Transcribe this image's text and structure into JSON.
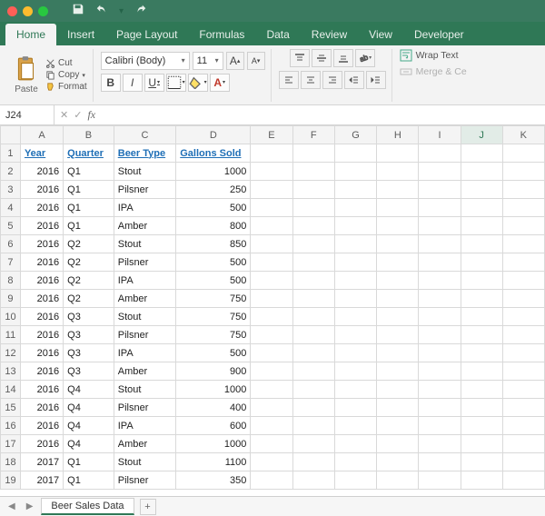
{
  "ribbon": {
    "tabs": [
      "Home",
      "Insert",
      "Page Layout",
      "Formulas",
      "Data",
      "Review",
      "View",
      "Developer"
    ],
    "active_tab": "Home",
    "paste_label": "Paste",
    "cut_label": "Cut",
    "copy_label": "Copy",
    "format_label": "Format",
    "font_name": "Calibri (Body)",
    "font_size": "11",
    "size_up": "A",
    "size_down": "A",
    "bold": "B",
    "italic": "I",
    "underline": "U",
    "wrap_label": "Wrap Text",
    "merge_label": "Merge & Ce"
  },
  "namebox": "J24",
  "fx_label": "fx",
  "columns": [
    "A",
    "B",
    "C",
    "D",
    "E",
    "F",
    "G",
    "H",
    "I",
    "J",
    "K"
  ],
  "selected_column": "J",
  "headers": {
    "A": "Year",
    "B": "Quarter",
    "C": "Beer Type",
    "D": "Gallons Sold"
  },
  "rows": [
    {
      "n": 2,
      "year": 2016,
      "quarter": "Q1",
      "beer": "Stout",
      "gallons": 1000
    },
    {
      "n": 3,
      "year": 2016,
      "quarter": "Q1",
      "beer": "Pilsner",
      "gallons": 250
    },
    {
      "n": 4,
      "year": 2016,
      "quarter": "Q1",
      "beer": "IPA",
      "gallons": 500
    },
    {
      "n": 5,
      "year": 2016,
      "quarter": "Q1",
      "beer": "Amber",
      "gallons": 800
    },
    {
      "n": 6,
      "year": 2016,
      "quarter": "Q2",
      "beer": "Stout",
      "gallons": 850
    },
    {
      "n": 7,
      "year": 2016,
      "quarter": "Q2",
      "beer": "Pilsner",
      "gallons": 500
    },
    {
      "n": 8,
      "year": 2016,
      "quarter": "Q2",
      "beer": "IPA",
      "gallons": 500
    },
    {
      "n": 9,
      "year": 2016,
      "quarter": "Q2",
      "beer": "Amber",
      "gallons": 750
    },
    {
      "n": 10,
      "year": 2016,
      "quarter": "Q3",
      "beer": "Stout",
      "gallons": 750
    },
    {
      "n": 11,
      "year": 2016,
      "quarter": "Q3",
      "beer": "Pilsner",
      "gallons": 750
    },
    {
      "n": 12,
      "year": 2016,
      "quarter": "Q3",
      "beer": "IPA",
      "gallons": 500
    },
    {
      "n": 13,
      "year": 2016,
      "quarter": "Q3",
      "beer": "Amber",
      "gallons": 900
    },
    {
      "n": 14,
      "year": 2016,
      "quarter": "Q4",
      "beer": "Stout",
      "gallons": 1000
    },
    {
      "n": 15,
      "year": 2016,
      "quarter": "Q4",
      "beer": "Pilsner",
      "gallons": 400
    },
    {
      "n": 16,
      "year": 2016,
      "quarter": "Q4",
      "beer": "IPA",
      "gallons": 600
    },
    {
      "n": 17,
      "year": 2016,
      "quarter": "Q4",
      "beer": "Amber",
      "gallons": 1000
    },
    {
      "n": 18,
      "year": 2017,
      "quarter": "Q1",
      "beer": "Stout",
      "gallons": 1100
    },
    {
      "n": 19,
      "year": 2017,
      "quarter": "Q1",
      "beer": "Pilsner",
      "gallons": 350
    }
  ],
  "sheet_tab": "Beer Sales Data"
}
